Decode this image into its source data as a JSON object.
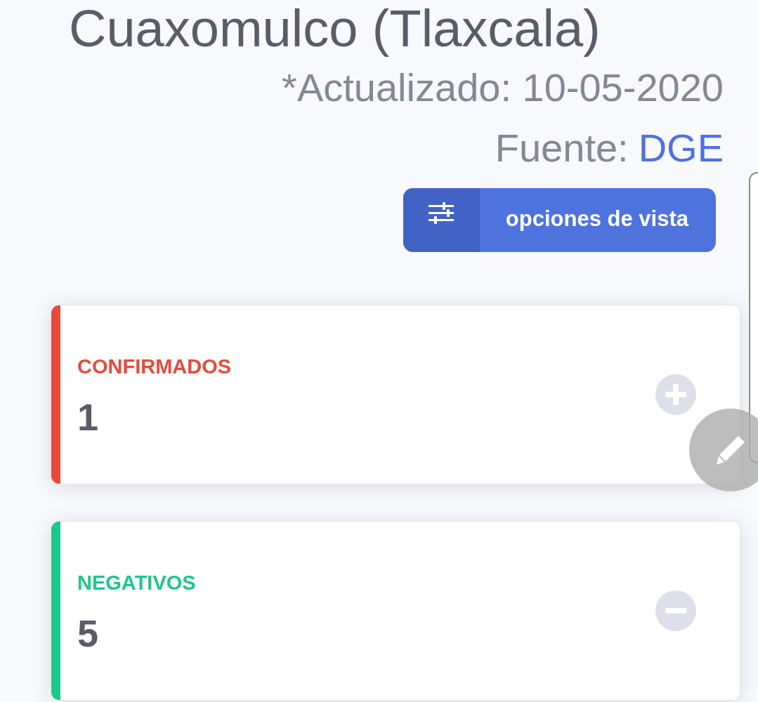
{
  "header": {
    "title": "Cuaxomulco (Tlaxcala)",
    "updated": "*Actualizado: 10-05-2020",
    "source_label": "Fuente:",
    "source_link": "DGE"
  },
  "view_options_button": {
    "label": "opciones de vista"
  },
  "cards": [
    {
      "kind": "plus",
      "label": "CONFIRMADOS",
      "value": "1",
      "color": "#e74a3b"
    },
    {
      "kind": "minus",
      "label": "NEGATIVOS",
      "value": "5",
      "color": "#1cc88a"
    }
  ]
}
